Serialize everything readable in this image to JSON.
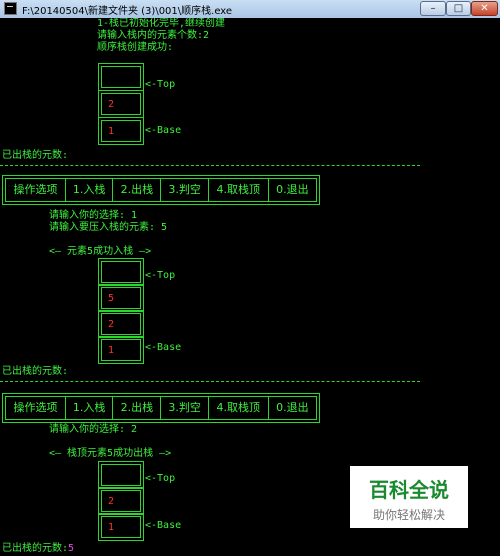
{
  "window": {
    "title": "F:\\20140504\\新建文件夹 (3)\\001\\顺序栈.exe",
    "buttons": {
      "minimize": "–",
      "maximize": "□",
      "close": "✕"
    }
  },
  "console": {
    "intro": {
      "line1": "1-栈已初始化完毕,继续创建",
      "line2": "请输入栈内的元素个数:2",
      "line3": "顺序栈创建成功:"
    },
    "stack1": {
      "cells": [
        "",
        "2",
        "1"
      ]
    },
    "top_label": "<-Top",
    "base_label": "<-Base",
    "popped_prefix": "已出栈的元数:",
    "popped_value": "5",
    "separator": "------------------------------------------------------------",
    "menu": [
      "操作选项",
      "1.入栈",
      "2.出栈",
      "3.判空",
      "4.取栈顶",
      "0.退出"
    ],
    "round1": {
      "choice_line": "请输入你的选择: 1",
      "push_prompt": "请输入要压入栈的元素: 5",
      "msg": "<— 元素5成功入栈 —>"
    },
    "stack2": {
      "cells": [
        "",
        "5",
        "2",
        "1"
      ]
    },
    "round2": {
      "choice_line": "请输入你的选择: 2",
      "msg": "<— 栈顶元素5成功出栈 —>"
    },
    "stack3": {
      "cells": [
        "",
        "2",
        "1"
      ]
    }
  },
  "watermark": {
    "title": "百科全说",
    "subtitle": "助你轻松解决"
  }
}
